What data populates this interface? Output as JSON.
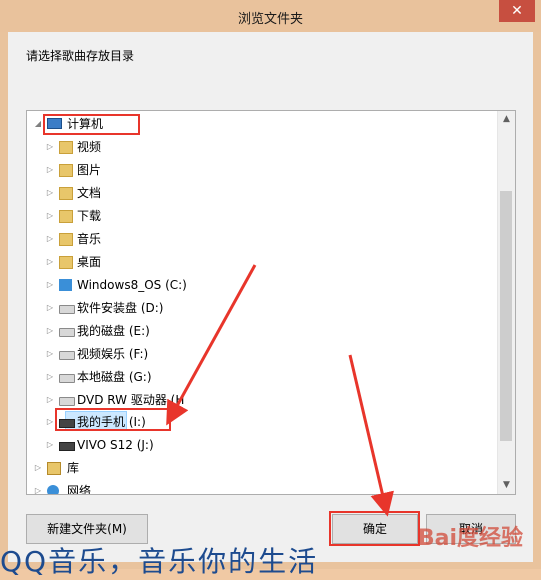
{
  "window": {
    "title": "浏览文件夹",
    "close_icon": "✕"
  },
  "prompt": "请选择歌曲存放目录",
  "tree": {
    "items": [
      {
        "label": "计算机",
        "icon": "computer-icon",
        "expanded": true
      },
      {
        "label": "视频",
        "icon": "video-folder-icon"
      },
      {
        "label": "图片",
        "icon": "pictures-folder-icon"
      },
      {
        "label": "文档",
        "icon": "documents-folder-icon"
      },
      {
        "label": "下载",
        "icon": "downloads-folder-icon"
      },
      {
        "label": "音乐",
        "icon": "music-folder-icon"
      },
      {
        "label": "桌面",
        "icon": "desktop-folder-icon"
      },
      {
        "label": "Windows8_OS (C:)",
        "icon": "windows-drive-icon"
      },
      {
        "label": "软件安装盘 (D:)",
        "icon": "drive-icon"
      },
      {
        "label": "我的磁盘 (E:)",
        "icon": "drive-icon"
      },
      {
        "label": "视频娱乐 (F:)",
        "icon": "drive-icon"
      },
      {
        "label": "本地磁盘 (G:)",
        "icon": "drive-icon"
      },
      {
        "label": "DVD RW 驱动器 (H",
        "icon": "dvd-drive-icon"
      },
      {
        "label": "我的手机 (I:)",
        "icon": "phone-drive-icon",
        "selected": true
      },
      {
        "label": "VIVO S12 (J:)",
        "icon": "phone-drive-icon"
      },
      {
        "label": "库",
        "icon": "library-icon"
      },
      {
        "label": "网络",
        "icon": "network-icon"
      }
    ]
  },
  "buttons": {
    "new_folder": "新建文件夹(M)",
    "ok": "确定",
    "cancel": "取消"
  },
  "watermark": {
    "caption": "QQ音乐，音乐你的生活",
    "logo": "Bai度经验"
  },
  "colors": {
    "highlight": "#e8352b",
    "selection": "#cce8ff"
  }
}
